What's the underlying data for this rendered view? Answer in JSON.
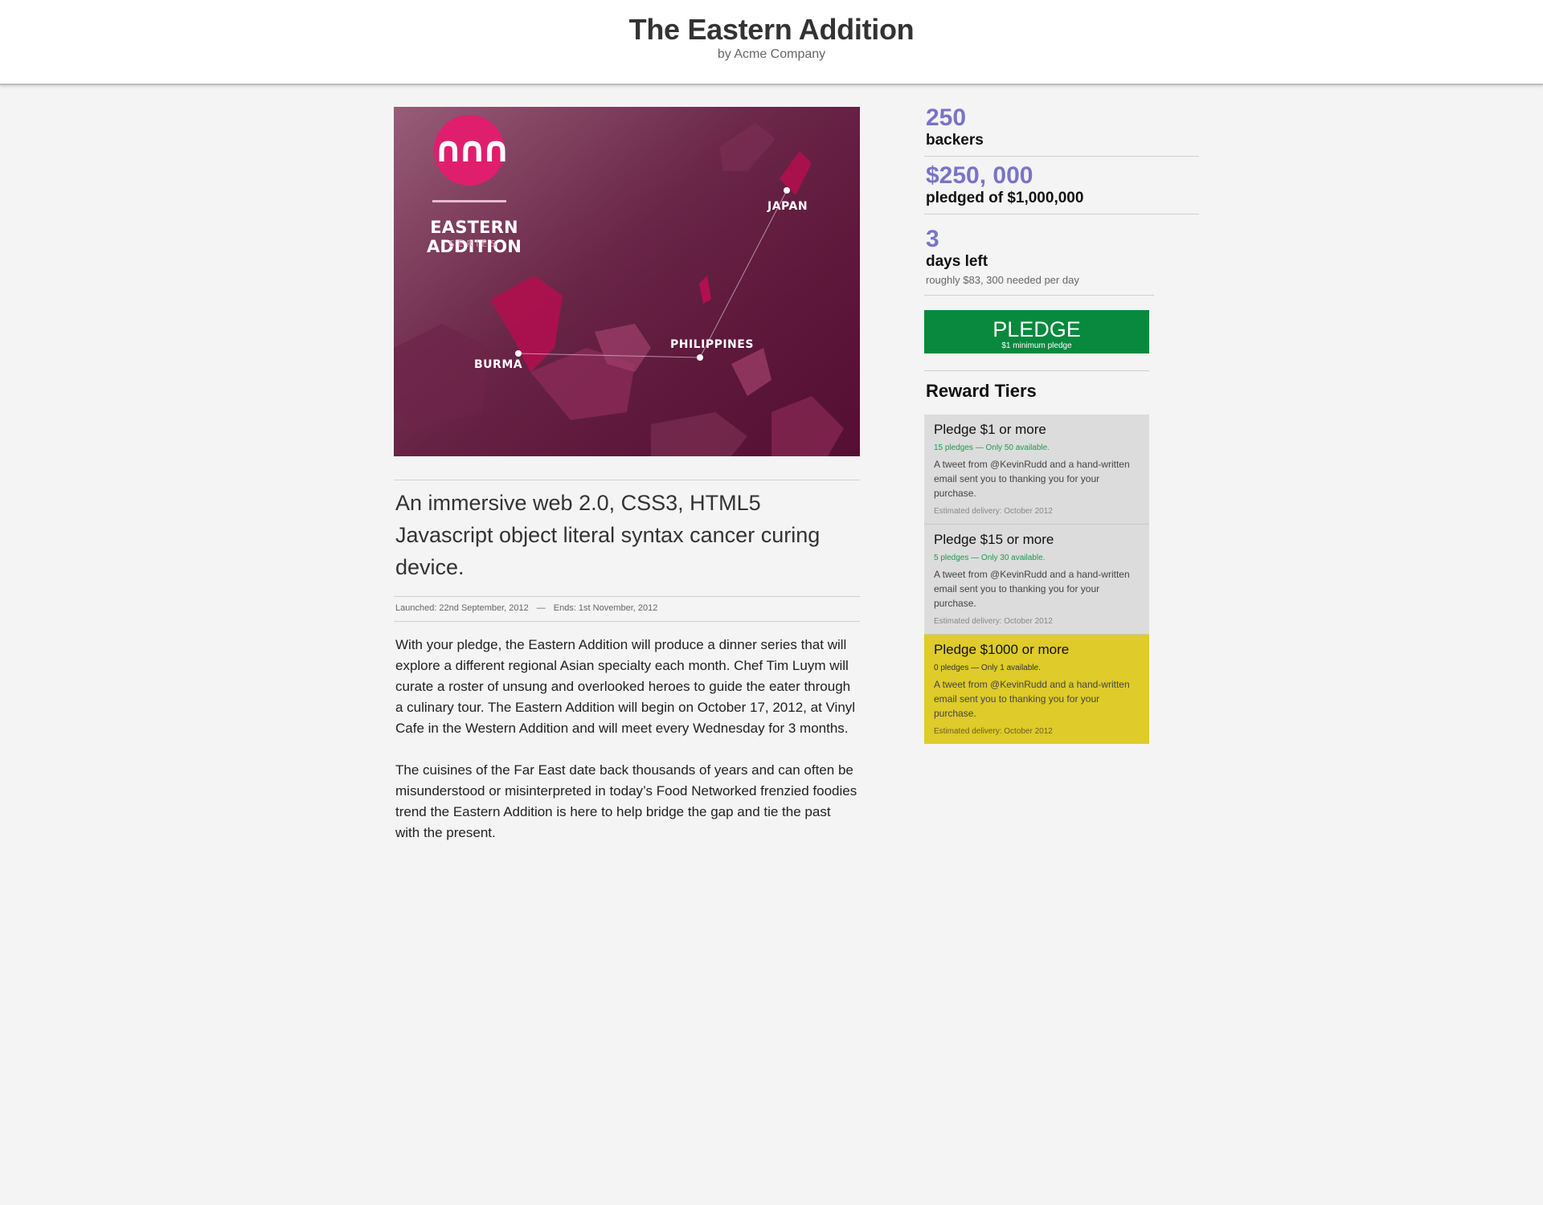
{
  "header": {
    "title": "The Eastern Addition",
    "byline": "by Acme Company"
  },
  "hero": {
    "series_title": "EASTERN ADDITION",
    "series_sub": "SERIES",
    "labels": {
      "japan": "JAPAN",
      "philippines": "PHILIPPINES",
      "burma": "BURMA"
    }
  },
  "project": {
    "tagline": "An immersive web 2.0, CSS3, HTML5 Javascript object literal syntax cancer curing device.",
    "launched": "Launched: 22nd September, 2012",
    "separator": "—",
    "ends": "Ends: 1st November, 2012",
    "paragraphs": [
      "With your pledge, the Eastern Addition will produce a dinner series that will explore a different regional Asian specialty each month. Chef Tim Luym will curate a roster of unsung and overlooked heroes to guide the eater through a culinary tour.  The Eastern Addition will begin on October 17, 2012, at Vinyl Cafe in the Western Addition and will meet every Wednesday for 3 months.",
      "The cuisines of the Far East date back thousands of years and can often be misunderstood or misinterpreted in today’s Food Networked frenzied foodies trend the Eastern Addition is here to help bridge the gap and tie the past with the present."
    ]
  },
  "stats": {
    "backers_count": "250",
    "backers_label": "backers",
    "pledged_amount": "$250, 000",
    "pledged_label": "pledged of $1,000,000",
    "days_count": "3",
    "days_label": "days left",
    "days_note": "roughly $83, 300 needed per day"
  },
  "pledge_button": {
    "label": "PLEDGE",
    "sub": "$1 minimum pledge"
  },
  "tiers": {
    "heading": "Reward Tiers",
    "items": [
      {
        "title": "Pledge $1 or more",
        "availability": "15 pledges — Only 50 available.",
        "description": "A tweet from @KevinRudd and a hand-written email sent you to thanking you for your purchase.",
        "delivery": "Estimated delivery: October 2012"
      },
      {
        "title": "Pledge $15 or more",
        "availability": "5 pledges — Only 30 available.",
        "description": "A tweet from @KevinRudd and a hand-written email sent you to thanking you for your purchase.",
        "delivery": "Estimated delivery: October 2012"
      },
      {
        "title": "Pledge $1000 or more",
        "availability": "0 pledges — Only 1 available.",
        "description": "A tweet from @KevinRudd and a hand-written email sent you to thanking you for your purchase.",
        "delivery": "Estimated delivery: October 2012"
      }
    ]
  },
  "colors": {
    "accent_stat": "#7b73c7",
    "pledge_green": "#08893e",
    "highlight_tier": "#dfcb29",
    "hero_bg": "#5e1a3c",
    "hero_highlight": "#e01e6e"
  },
  "icons": {
    "logo": "wave-logo-icon"
  }
}
